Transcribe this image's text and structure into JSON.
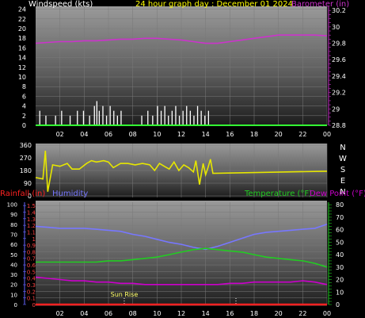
{
  "chart_data": [
    {
      "type": "bar",
      "title": "24 hour graph day : December 01 2024",
      "left_label": "Windspeed (kts)",
      "right_label": "Barometer (in)",
      "left_ticks": [
        "0",
        "2",
        "4",
        "6",
        "8",
        "10",
        "12",
        "14",
        "16",
        "18",
        "20",
        "22",
        "24"
      ],
      "right_ticks": [
        "28.8",
        "29",
        "29.2",
        "29.4",
        "29.6",
        "29.8",
        "30",
        "30.2"
      ],
      "x_ticks": [
        "02",
        "04",
        "06",
        "08",
        "10",
        "12",
        "14",
        "16",
        "18",
        "20",
        "22",
        "00"
      ],
      "ylim_left": [
        0,
        24.6
      ],
      "ylim_right": [
        28.8,
        30.25
      ],
      "barometer": {
        "name": "Barometer (in)",
        "x": [
          0,
          1,
          2,
          3,
          4,
          5,
          6,
          7,
          8,
          9,
          10,
          11,
          12,
          13,
          14,
          15,
          16,
          17,
          18,
          19,
          20,
          21,
          22,
          23,
          24
        ],
        "values": [
          29.8,
          29.81,
          29.82,
          29.82,
          29.83,
          29.83,
          29.84,
          29.85,
          29.85,
          29.86,
          29.86,
          29.85,
          29.84,
          29.82,
          29.8,
          29.8,
          29.82,
          29.84,
          29.86,
          29.88,
          29.9,
          29.9,
          29.9,
          29.9,
          29.89
        ]
      },
      "wind": {
        "name": "Windspeed (kts)",
        "x": [
          0.3,
          0.8,
          1.6,
          2.1,
          2.8,
          3.4,
          3.9,
          4.4,
          4.8,
          5.0,
          5.2,
          5.5,
          5.8,
          6.1,
          6.4,
          6.7,
          7.0,
          8.7,
          9.2,
          9.6,
          10.0,
          10.3,
          10.6,
          10.9,
          11.2,
          11.5,
          11.8,
          12.1,
          12.4,
          12.7,
          13.0,
          13.3,
          13.6,
          13.9,
          14.2
        ],
        "values": [
          3,
          2,
          2,
          3,
          2,
          3,
          3,
          2,
          4,
          5,
          3,
          4,
          2,
          4,
          3,
          2,
          3,
          2,
          3,
          2,
          4,
          3,
          4,
          2,
          3,
          4,
          2,
          3,
          4,
          3,
          2,
          4,
          3,
          2,
          3
        ]
      }
    },
    {
      "type": "line",
      "left_ticks": [
        "0",
        "90",
        "180",
        "270",
        "360"
      ],
      "right_labels": [
        "N",
        "W",
        "S",
        "E",
        "N"
      ],
      "x_ticks": [
        "02",
        "04",
        "06",
        "08",
        "10",
        "12",
        "14",
        "16",
        "18",
        "20",
        "22",
        "00"
      ],
      "ylim": [
        0,
        360
      ],
      "direction": {
        "name": "Wind direction",
        "x": [
          0.0,
          0.6,
          0.8,
          1.0,
          1.4,
          2.0,
          2.6,
          3.0,
          3.6,
          4.2,
          4.6,
          5.0,
          5.6,
          6.0,
          6.4,
          7.0,
          7.6,
          8.2,
          8.8,
          9.4,
          9.8,
          10.2,
          10.6,
          11.0,
          11.4,
          11.8,
          12.2,
          12.6,
          13.0,
          13.2,
          13.5,
          13.8,
          14.0,
          14.2,
          14.4,
          14.6,
          24.0
        ],
        "values": [
          130,
          120,
          320,
          30,
          220,
          210,
          230,
          190,
          190,
          230,
          250,
          240,
          250,
          240,
          200,
          230,
          230,
          220,
          230,
          220,
          180,
          230,
          210,
          190,
          240,
          180,
          220,
          200,
          170,
          250,
          80,
          230,
          150,
          200,
          260,
          160,
          175
        ]
      }
    },
    {
      "type": "line",
      "labels": {
        "rainfall": "Rainfall (in)",
        "humidity": "Humidity",
        "temperature": "Temperature (°F)",
        "dewpoint": "Dew Point (°F)",
        "sunrise": "Sun Rise"
      },
      "humidity_ticks": [
        "0",
        "10",
        "20",
        "30",
        "40",
        "50",
        "60",
        "70",
        "80",
        "90",
        "100"
      ],
      "rain_ticks": [
        "0",
        "0.1",
        "0.2",
        "0.3",
        "0.4",
        "0.5",
        "0.6",
        "0.7",
        "0.8",
        "0.9",
        "1",
        "1.1",
        "1.2",
        "1.3",
        "1.4",
        "1.5"
      ],
      "temp_ticks": [
        "0",
        "10",
        "20",
        "30",
        "40",
        "50",
        "60",
        "70",
        "80"
      ],
      "x_ticks": [
        "02",
        "04",
        "06",
        "08",
        "10",
        "12",
        "14",
        "16",
        "18",
        "20",
        "22",
        "00"
      ],
      "ylim_humidity": [
        0,
        102
      ],
      "ylim_rain": [
        0,
        1.55
      ],
      "ylim_temp": [
        0,
        82
      ],
      "sunrise_hour": 7.3,
      "sunset_hour": 16.5,
      "humidity": {
        "name": "Humidity",
        "x": [
          0,
          1,
          2,
          3,
          4,
          5,
          6,
          7,
          8,
          9,
          10,
          11,
          12,
          13,
          14,
          15,
          16,
          17,
          18,
          19,
          20,
          21,
          22,
          23,
          24
        ],
        "values": [
          78,
          77,
          76,
          76,
          76,
          75,
          74,
          73,
          70,
          68,
          65,
          62,
          60,
          57,
          55,
          58,
          62,
          66,
          70,
          72,
          73,
          74,
          75,
          76,
          80
        ]
      },
      "temperature": {
        "name": "Temperature (°F)",
        "x": [
          0,
          1,
          2,
          3,
          4,
          5,
          6,
          7,
          8,
          9,
          10,
          11,
          12,
          13,
          14,
          15,
          16,
          17,
          18,
          19,
          20,
          21,
          22,
          23,
          24
        ],
        "values": [
          34,
          34,
          34,
          34,
          34,
          34,
          35,
          35,
          36,
          37,
          38,
          40,
          42,
          44,
          45,
          44,
          43,
          42,
          40,
          38,
          37,
          36,
          35,
          33,
          30
        ]
      },
      "dewpoint": {
        "name": "Dew Point (°F)",
        "x": [
          0,
          1,
          2,
          3,
          4,
          5,
          6,
          7,
          8,
          9,
          10,
          11,
          12,
          13,
          14,
          15,
          16,
          17,
          18,
          19,
          20,
          21,
          22,
          23,
          24
        ],
        "values": [
          22,
          21,
          20,
          19,
          19,
          18,
          18,
          17,
          17,
          16,
          16,
          16,
          16,
          16,
          16,
          16,
          17,
          17,
          18,
          18,
          18,
          18,
          19,
          18,
          16
        ]
      },
      "rainfall": {
        "name": "Rainfall (in)",
        "x": [
          0,
          24
        ],
        "values": [
          0,
          0
        ]
      }
    }
  ],
  "colors": {
    "wind": "#ffffff",
    "barometer": "#cc33cc",
    "direction": "#e6e600",
    "humidity": "#7777ff",
    "temperature": "#22cc22",
    "dewpoint": "#cc00cc",
    "rainfall": "#ff2222",
    "title": "#ffff00",
    "baseline_green": "#33ff33"
  }
}
